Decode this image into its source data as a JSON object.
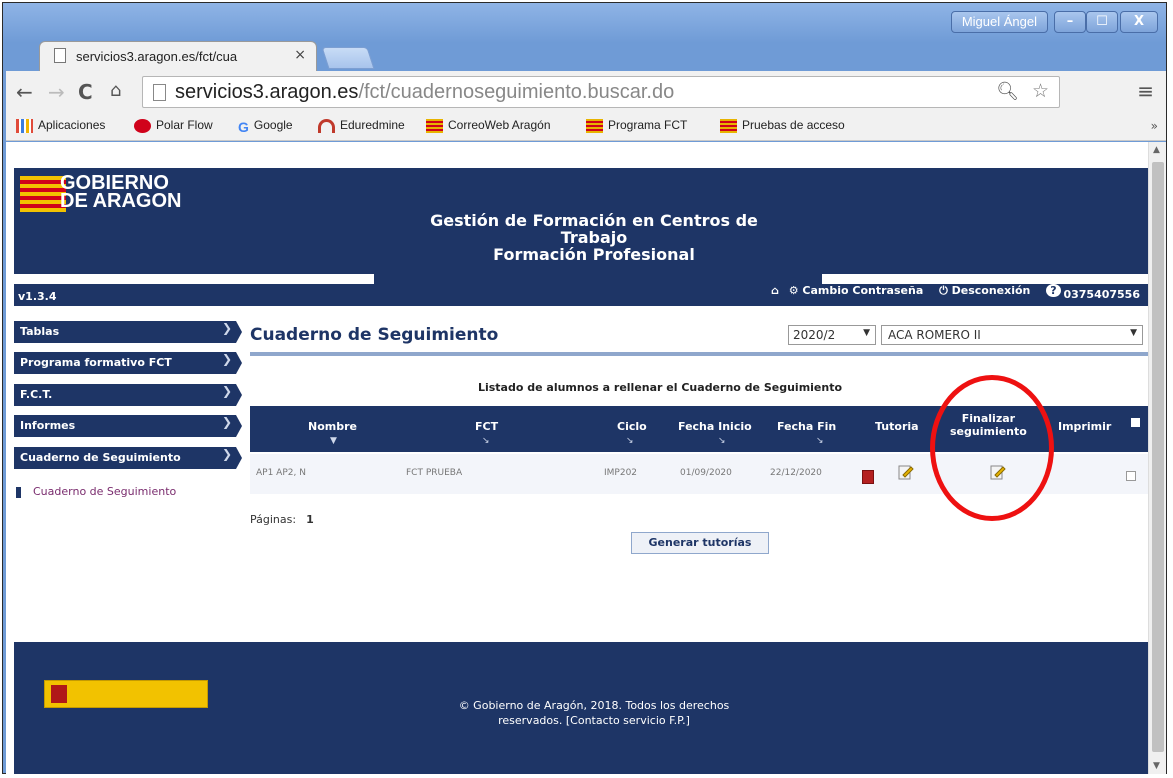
{
  "browser": {
    "user_chip": "Miguel Ángel",
    "window_buttons": {
      "minimize": "–",
      "maximize": "☐",
      "close": "X"
    },
    "tab": {
      "title": "servicios3.aragon.es/fct/cua",
      "close": "×"
    },
    "url": {
      "host": "servicios3.aragon.es",
      "path": "/fct/cuadernoseguimiento.buscar.do"
    },
    "nav": {
      "back": "←",
      "forward": "→",
      "reload": "C",
      "home": "⌂"
    },
    "bookmarks": [
      {
        "label": "Aplicaciones",
        "color": "#e04b3a"
      },
      {
        "label": "Polar Flow",
        "color": "#d0021b"
      },
      {
        "label": "Google",
        "color": "#4285f4"
      },
      {
        "label": "Eduredmine",
        "color": "#c0392b"
      },
      {
        "label": "CorreoWeb Aragón",
        "color": "#e8b400"
      },
      {
        "label": "Programa FCT",
        "color": "#e8b400"
      },
      {
        "label": "Pruebas de acceso",
        "color": "#e8b400"
      }
    ],
    "bookmarks_more": "»"
  },
  "header": {
    "logo_line1": "GOBIERNO",
    "logo_line2": "DE ARAGON",
    "title_line1": "Gestión de Formación en Centros de",
    "title_line2": "Trabajo",
    "title_line3": "Formación Profesional",
    "version": "v1.3.4",
    "user_code": "0375407556",
    "links": {
      "home": "⌂",
      "change_password": "Cambio Contraseña",
      "logout": "Desconexión",
      "help": "?"
    }
  },
  "sidebar": {
    "items": [
      {
        "label": "Tablas"
      },
      {
        "label": "Programa formativo FCT"
      },
      {
        "label": "F.C.T."
      },
      {
        "label": "Informes"
      },
      {
        "label": "Cuaderno de Seguimiento"
      }
    ],
    "sub_item": "Cuaderno de Seguimiento",
    "arrow": "❯"
  },
  "main": {
    "title": "Cuaderno de Seguimiento",
    "period": "2020/2",
    "center": "ACA ROMERO II",
    "list_caption": "Listado de alumnos a rellenar el Cuaderno de Seguimiento",
    "columns": {
      "nombre": "Nombre",
      "fct": "FCT",
      "ciclo": "Ciclo",
      "fecha_inicio": "Fecha Inicio",
      "fecha_fin": "Fecha Fin",
      "tutoria": "Tutoria",
      "finalizar_1": "Finalizar",
      "finalizar_2": "seguimiento",
      "imprimir": "Imprimir"
    },
    "row": {
      "nombre": "AP1 AP2, N",
      "fct": "FCT PRUEBA",
      "ciclo": "IMP202",
      "fecha_inicio": "01/09/2020",
      "fecha_fin": "22/12/2020"
    },
    "pages_label": "Páginas:",
    "pages_value": "1",
    "generate_button": "Generar tutorías"
  },
  "footer": {
    "line1": "© Gobierno de Aragón, 2018. Todos los derechos",
    "line2": "reservados.   [Contacto servicio F.P.]"
  },
  "colors": {
    "brand_navy": "#1e3566",
    "annotation": "#ee1111"
  }
}
